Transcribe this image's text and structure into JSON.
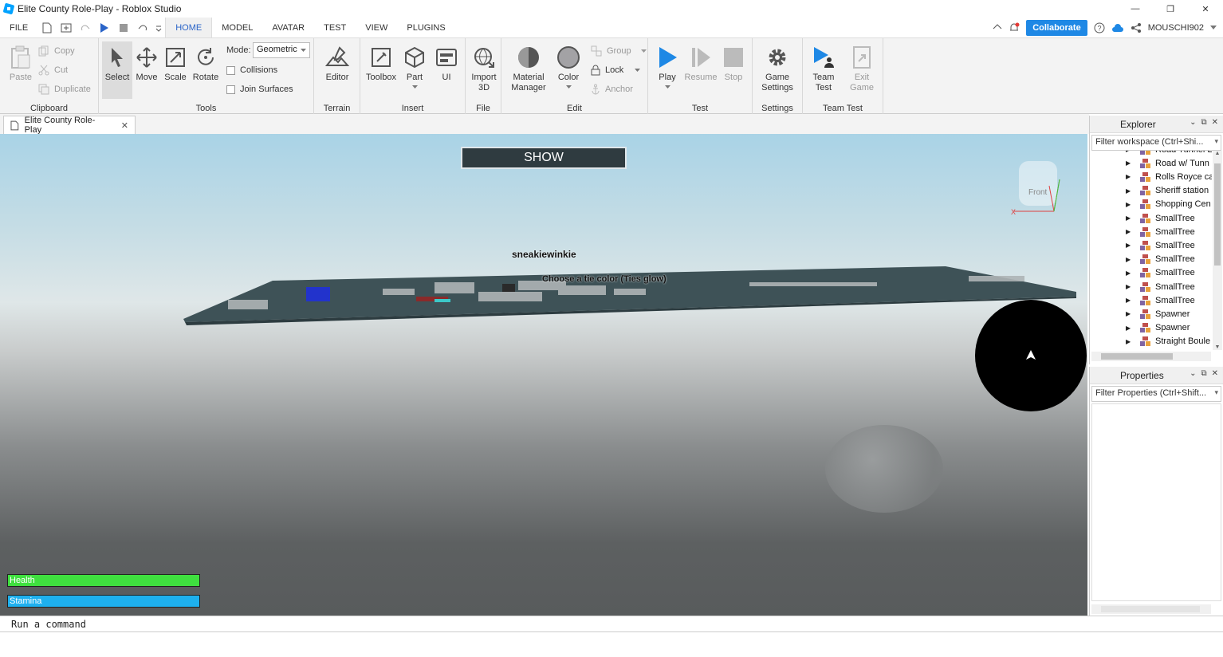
{
  "window": {
    "title": "Elite County Role-Play - Roblox Studio",
    "controls": [
      "—",
      "❐",
      "✕"
    ]
  },
  "menu": {
    "file": "FILE",
    "tabs": [
      "HOME",
      "MODEL",
      "AVATAR",
      "TEST",
      "VIEW",
      "PLUGINS"
    ],
    "active_tab": "HOME",
    "collaborate": "Collaborate",
    "user": "MOUSCHI902"
  },
  "ribbon": {
    "clipboard": {
      "label": "Clipboard",
      "paste": "Paste",
      "copy": "Copy",
      "cut": "Cut",
      "duplicate": "Duplicate"
    },
    "tools": {
      "label": "Tools",
      "select": "Select",
      "move": "Move",
      "scale": "Scale",
      "rotate": "Rotate",
      "mode_label": "Mode:",
      "mode_value": "Geometric",
      "collisions": "Collisions",
      "join_surfaces": "Join Surfaces"
    },
    "terrain": {
      "label": "Terrain",
      "editor": "Editor"
    },
    "insert": {
      "label": "Insert",
      "toolbox": "Toolbox",
      "part": "Part",
      "ui": "UI"
    },
    "file": {
      "label": "File",
      "import_1": "Import",
      "import_2": "3D"
    },
    "edit": {
      "label": "Edit",
      "material_1": "Material",
      "material_2": "Manager",
      "color": "Color",
      "group": "Group",
      "lock": "Lock",
      "anchor": "Anchor"
    },
    "test": {
      "label": "Test",
      "play": "Play",
      "resume": "Resume",
      "stop": "Stop"
    },
    "settings": {
      "label": "Settings",
      "game_1": "Game",
      "game_2": "Settings"
    },
    "team_test": {
      "label": "Team Test",
      "team_1": "Team",
      "team_2": "Test",
      "exit_1": "Exit",
      "exit_2": "Game"
    }
  },
  "doc_tab": {
    "title": "Elite County Role-Play"
  },
  "viewport": {
    "show_button": "SHOW",
    "player_name": "sneakiewinkie",
    "tie_label": "Choose a tie color (Ties glow)",
    "health_label": "Health",
    "stamina_label": "Stamina",
    "view_cube_label": "Front"
  },
  "explorer": {
    "title": "Explorer",
    "filter": "Filter workspace (Ctrl+Shi...",
    "items": [
      "Road Tunnel E",
      "Road w/ Tunn",
      "Rolls Royce ca",
      "Sheriff station",
      "Shopping Cen",
      "SmallTree",
      "SmallTree",
      "SmallTree",
      "SmallTree",
      "SmallTree",
      "SmallTree",
      "SmallTree",
      "Spawner",
      "Spawner",
      "Straight Boule"
    ]
  },
  "properties": {
    "title": "Properties",
    "filter": "Filter Properties (Ctrl+Shift..."
  },
  "command_bar": {
    "placeholder": "Run a command"
  }
}
